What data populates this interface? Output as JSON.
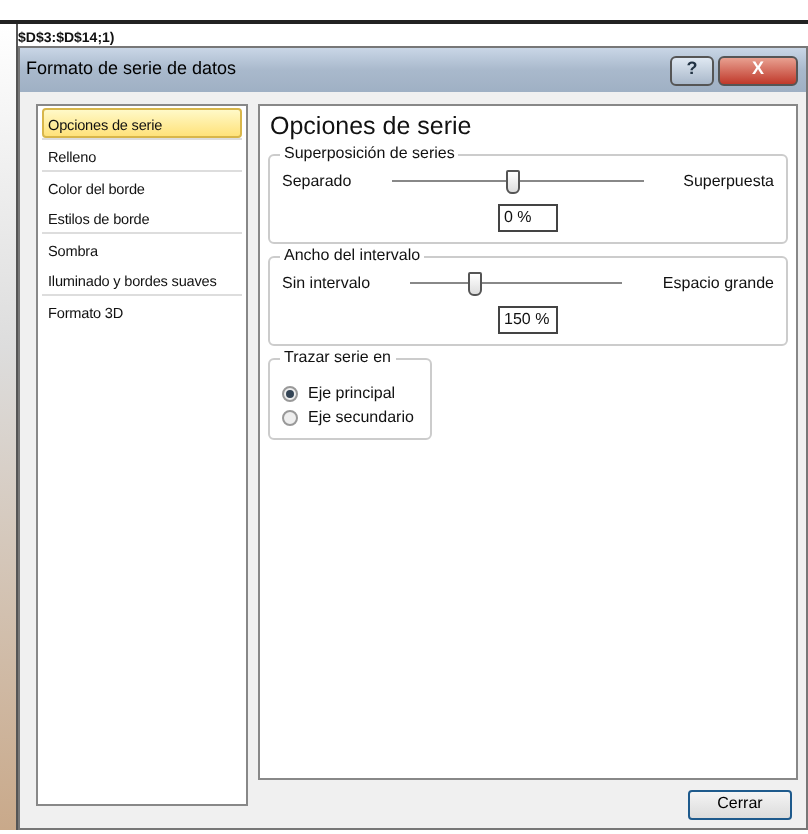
{
  "background_text": "$D$3:$D$14;1)",
  "window": {
    "title": "Formato de serie de datos",
    "buttons": [
      "?",
      "X"
    ]
  },
  "sidebar": {
    "items": [
      {
        "label": "Opciones de serie",
        "selected": true
      },
      {
        "label": "Relleno",
        "selected": false
      },
      {
        "label": "Color del borde",
        "selected": false
      },
      {
        "label": "Estilos de borde",
        "selected": false
      },
      {
        "label": "Sombra",
        "selected": false
      },
      {
        "label": "Iluminado y bordes suaves",
        "selected": false
      },
      {
        "label": "Formato 3D",
        "selected": false
      }
    ]
  },
  "panel": {
    "title": "Opciones de serie",
    "groups": [
      {
        "kind": "slider",
        "legend": "Superposición de series",
        "left_label": "Separado",
        "right_label": "Superpuesta",
        "level": 0.48,
        "value": "0 %"
      },
      {
        "kind": "slider",
        "legend": "Ancho del intervalo",
        "left_label": "Sin intervalo",
        "right_label": "Espacio grande",
        "level": 0.3,
        "value": "150 %"
      },
      {
        "kind": "radio",
        "legend": "Trazar serie en",
        "options": [
          {
            "label": "Eje principal",
            "selected": true
          },
          {
            "label": "Eje secundario",
            "selected": false
          }
        ]
      }
    ]
  },
  "footer": {
    "button": "Cerrar"
  }
}
